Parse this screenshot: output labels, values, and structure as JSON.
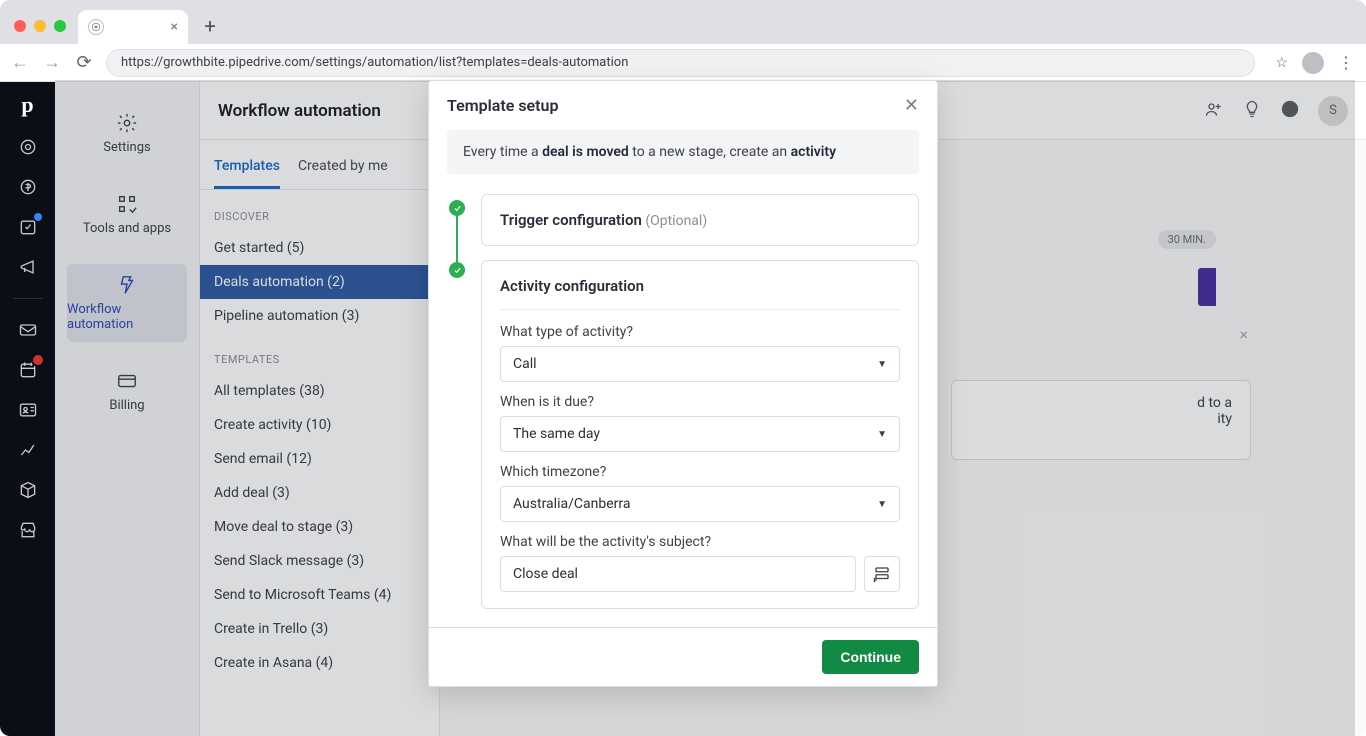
{
  "browser": {
    "url": "https://growthbite.pipedrive.com/settings/automation/list?templates=deals-automation"
  },
  "header": {
    "title": "Workflow automation",
    "user_initial": "S"
  },
  "settings_nav": {
    "items": [
      {
        "label": "Settings"
      },
      {
        "label": "Tools and apps"
      },
      {
        "label": "Workflow automation"
      },
      {
        "label": "Billing"
      }
    ]
  },
  "tabs": {
    "templates": "Templates",
    "created": "Created by me"
  },
  "discover": {
    "label": "DISCOVER",
    "items": [
      {
        "label": "Get started (5)"
      },
      {
        "label": "Deals automation (2)"
      },
      {
        "label": "Pipeline automation (3)"
      }
    ]
  },
  "templates": {
    "label": "TEMPLATES",
    "items": [
      {
        "label": "All templates (38)"
      },
      {
        "label": "Create activity (10)"
      },
      {
        "label": "Send email (12)"
      },
      {
        "label": "Add deal (3)"
      },
      {
        "label": "Move deal to stage (3)"
      },
      {
        "label": "Send Slack message (3)"
      },
      {
        "label": "Send to Microsoft Teams (4)"
      },
      {
        "label": "Create in Trello (3)"
      },
      {
        "label": "Create in Asana (4)"
      }
    ]
  },
  "bg": {
    "badge": "30 MIN.",
    "desc1": "d to a",
    "desc2": "ity"
  },
  "modal": {
    "title": "Template setup",
    "banner": {
      "p1": "Every time a ",
      "b1": "deal is moved",
      "p2": " to a new stage, create an ",
      "b2": "activity"
    },
    "trigger": {
      "title": "Trigger configuration",
      "optional": "(Optional)"
    },
    "activity": {
      "title": "Activity configuration",
      "type_label": "What type of activity?",
      "type_value": "Call",
      "due_label": "When is it due?",
      "due_value": "The same day",
      "tz_label": "Which timezone?",
      "tz_value": "Australia/Canberra",
      "subj_label": "What will be the activity's subject?",
      "subj_value": "Close deal"
    },
    "continue": "Continue"
  }
}
